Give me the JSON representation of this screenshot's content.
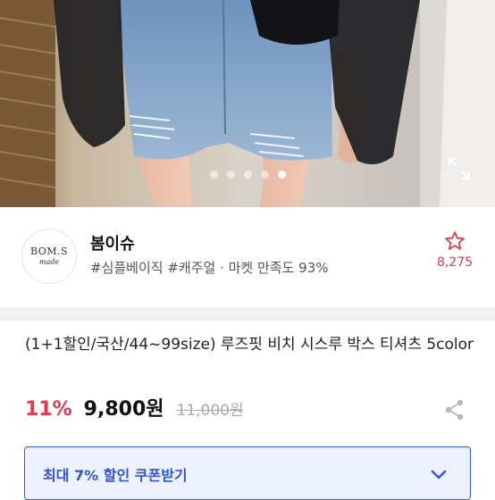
{
  "shop": {
    "logo_line1": "BOM.S",
    "logo_line2": "made",
    "name": "봄이슈",
    "meta": "#심플베이직 #캐주얼 · 마켓 만족도 93%",
    "fav_count": "8,275"
  },
  "gallery": {
    "dot_count": 5,
    "active_index": 3
  },
  "product": {
    "title": "(1+1할인/국산/44~99size) 루즈핏 비치 시스루 박스 티셔츠 5color",
    "discount": "11%",
    "price": "9,800원",
    "original_price": "11,000원"
  },
  "coupon": {
    "label": "최대 7% 할인 쿠폰받기"
  },
  "colors": {
    "accent_red": "#e8384f",
    "accent_blue": "#2f56d8"
  },
  "icons": [
    "expand-icon",
    "star-icon",
    "share-icon",
    "chevron-down-icon"
  ]
}
